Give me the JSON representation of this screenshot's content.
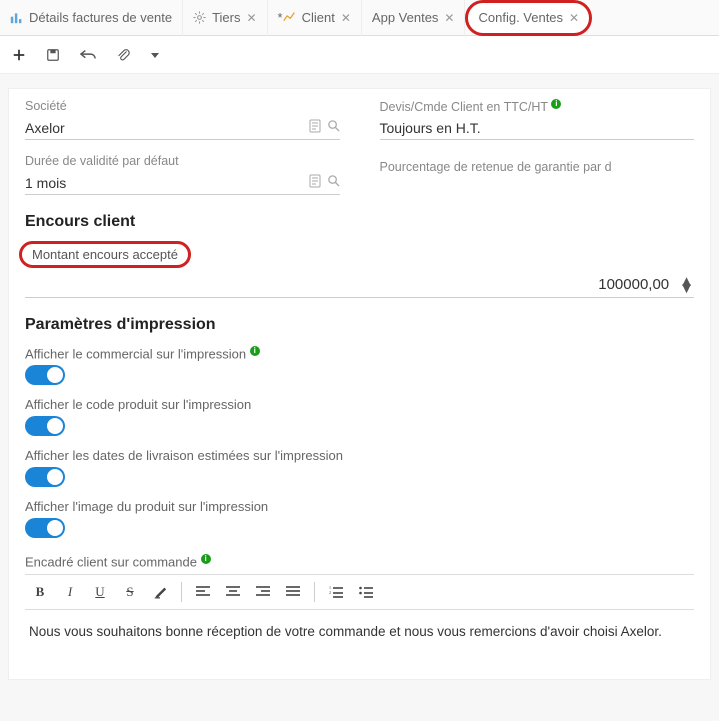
{
  "tabs": [
    {
      "label": "Détails factures de vente",
      "icon": "bar-chart",
      "closable": false
    },
    {
      "label": "Tiers",
      "icon": "gear",
      "closable": true
    },
    {
      "label": "Client",
      "icon": "line-chart",
      "closable": true,
      "dirty": "* "
    },
    {
      "label": "App Ventes",
      "icon": "",
      "closable": true
    },
    {
      "label": "Config. Ventes",
      "icon": "",
      "closable": true,
      "highlighted": true
    }
  ],
  "fields": {
    "societe_label": "Société",
    "societe_value": "Axelor",
    "devis_label": "Devis/Cmde Client en TTC/HT",
    "devis_value": "Toujours en H.T.",
    "duree_label": "Durée de validité par défaut",
    "duree_value": "1 mois",
    "retenue_label": "Pourcentage de retenue de garantie par d"
  },
  "sections": {
    "encours_title": "Encours client",
    "montant_label": "Montant encours accepté",
    "montant_value": "100000,00",
    "impression_title": "Paramètres d'impression"
  },
  "toggles": {
    "commercial": "Afficher le commercial sur l'impression",
    "code_produit": "Afficher le code produit sur l'impression",
    "dates_livraison": "Afficher les dates de livraison estimées sur l'impression",
    "image_produit": "Afficher l'image du produit sur l'impression"
  },
  "rte": {
    "label": "Encadré client sur commande",
    "content": "Nous vous souhaitons bonne réception de votre commande et nous vous remercions d'avoir choisi Axelor."
  }
}
